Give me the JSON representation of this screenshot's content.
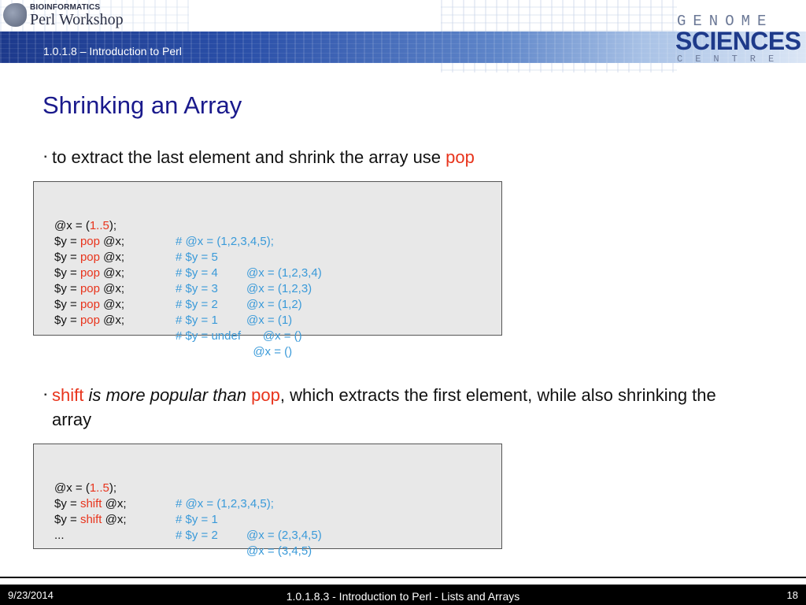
{
  "header": {
    "logo_line1": "BIOINFORMATICS",
    "logo_line2": "Perl Workshop",
    "subtitle": "1.0.1.8 – Introduction to Perl",
    "brand_top": "GENOME",
    "brand_mid": "SCIENCES",
    "brand_bot": "CENTRE"
  },
  "slide": {
    "title": "Shrinking an Array",
    "bullet1": {
      "text": "to extract the last element and shrink the array use ",
      "keyword": "pop"
    },
    "code1": [
      {
        "pre": "@x = (",
        "kw": "1..5",
        "post": ");",
        "c1": "# @x = (1,2,3,4,5);",
        "c2": ""
      },
      {
        "pre": "$y = ",
        "kw": "pop",
        "post": " @x;",
        "c1": "# $y = 5",
        "c2": "@x = (1,2,3,4)"
      },
      {
        "pre": "$y = ",
        "kw": "pop",
        "post": " @x;",
        "c1": "# $y = 4",
        "c2": "@x = (1,2,3)"
      },
      {
        "pre": "$y = ",
        "kw": "pop",
        "post": " @x;",
        "c1": "# $y = 3",
        "c2": "@x = (1,2)"
      },
      {
        "pre": "$y = ",
        "kw": "pop",
        "post": " @x;",
        "c1": "# $y = 2",
        "c2": "@x = (1)"
      },
      {
        "pre": "$y = ",
        "kw": "pop",
        "post": " @x;",
        "c1": "# $y = 1",
        "c2": "     @x = ()"
      },
      {
        "pre": "$y = ",
        "kw": "pop",
        "post": " @x;",
        "c1": "# $y = undef",
        "c2": "  @x = ()"
      }
    ],
    "bullet2": {
      "kw1": "shift",
      "ital": " is more popular than ",
      "kw2": "pop",
      "rest": ", which extracts the first element, while also shrinking the array"
    },
    "code2": [
      {
        "pre": "@x = (",
        "kw": "1..5",
        "post": ");",
        "c1": "# @x = (1,2,3,4,5);",
        "c2": ""
      },
      {
        "pre": "$y = ",
        "kw": "shift",
        "post": " @x;",
        "c1": "# $y = 1",
        "c2": "@x = (2,3,4,5)"
      },
      {
        "pre": "$y = ",
        "kw": "shift",
        "post": " @x;",
        "c1": "# $y = 2",
        "c2": "@x = (3,4,5)"
      },
      {
        "pre": "...",
        "kw": "",
        "post": "",
        "c1": "",
        "c2": ""
      }
    ]
  },
  "footer": {
    "date": "9/23/2014",
    "title": "1.0.1.8.3 - Introduction to Perl - Lists and Arrays",
    "page": "18"
  },
  "colors": {
    "title": "#1a1a8c",
    "keyword": "#e8341c",
    "comment": "#3a9ad9",
    "code_bg": "#e8e8e8"
  }
}
